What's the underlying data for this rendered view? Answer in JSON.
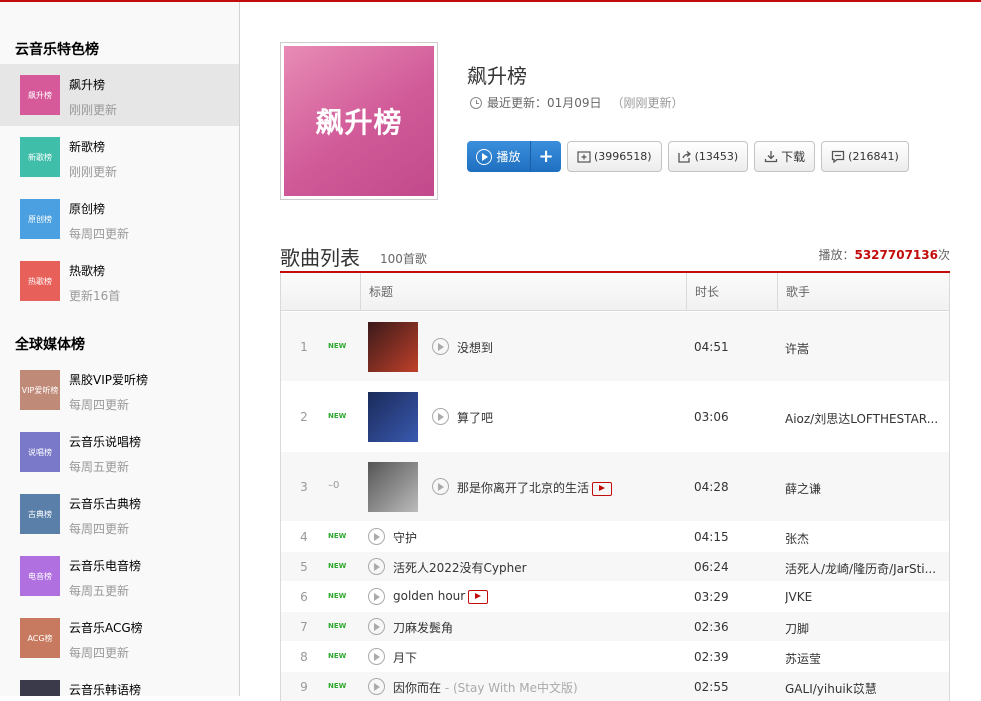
{
  "sidebar": {
    "sections": [
      {
        "title": "云音乐特色榜",
        "items": [
          {
            "name": "飙升榜",
            "update": "刚刚更新",
            "thumb_text": "飙升榜",
            "color": "#d65a9a",
            "active": true
          },
          {
            "name": "新歌榜",
            "update": "刚刚更新",
            "thumb_text": "新歌榜",
            "color": "#3fbfaa"
          },
          {
            "name": "原创榜",
            "update": "每周四更新",
            "thumb_text": "原创榜",
            "color": "#4aa0e0"
          },
          {
            "name": "热歌榜",
            "update": "更新16首",
            "thumb_text": "热歌榜",
            "color": "#e8605a"
          }
        ]
      },
      {
        "title": "全球媒体榜",
        "items": [
          {
            "name": "黑胶VIP爱听榜",
            "update": "每周四更新",
            "thumb_text": "VIP爱听榜",
            "color": "#c08a78"
          },
          {
            "name": "云音乐说唱榜",
            "update": "每周五更新",
            "thumb_text": "说唱榜",
            "color": "#7a78c8"
          },
          {
            "name": "云音乐古典榜",
            "update": "每周四更新",
            "thumb_text": "古典榜",
            "color": "#5a7fa8"
          },
          {
            "name": "云音乐电音榜",
            "update": "每周五更新",
            "thumb_text": "电音榜",
            "color": "#b070e0"
          },
          {
            "name": "云音乐ACG榜",
            "update": "每周四更新",
            "thumb_text": "ACG榜",
            "color": "#c87a60"
          },
          {
            "name": "云音乐韩语榜",
            "update": "",
            "thumb_text": "",
            "color": "#3a3a4a"
          }
        ]
      }
    ]
  },
  "header": {
    "cover_text": "飙升榜",
    "title": "飙升榜",
    "update_label": "最近更新：01月09日",
    "update_note": "（刚刚更新）",
    "play_label": "播放",
    "plus_label": "+",
    "collect_label": "(3996518)",
    "share_label": "(13453)",
    "download_label": "下载",
    "comment_label": "(216841)"
  },
  "songs": {
    "title": "歌曲列表",
    "count": "100首歌",
    "play_prefix": "播放：",
    "play_count": "5327707136",
    "play_suffix": "次",
    "columns": [
      "标题",
      "时长",
      "歌手"
    ],
    "rows": [
      {
        "rank": "1",
        "trend": "NEW",
        "title": "没想到",
        "alt": "",
        "mv": false,
        "duration": "04:51",
        "artist": "许嵩",
        "cover": true,
        "cover_colors": [
          "#3a1a1a",
          "#c0402a"
        ]
      },
      {
        "rank": "2",
        "trend": "NEW",
        "title": "算了吧",
        "alt": "",
        "mv": false,
        "duration": "03:06",
        "artist": "Aioz/刘思达LOFTHESTAR...",
        "cover": true,
        "cover_colors": [
          "#1a2a5a",
          "#3a5ab0"
        ]
      },
      {
        "rank": "3",
        "trend": "–0",
        "title": "那是你离开了北京的生活",
        "alt": "",
        "mv": true,
        "duration": "04:28",
        "artist": "薛之谦",
        "cover": true,
        "cover_colors": [
          "#555555",
          "#bbbbbb"
        ]
      },
      {
        "rank": "4",
        "trend": "NEW",
        "title": "守护",
        "alt": "",
        "mv": false,
        "duration": "04:15",
        "artist": "张杰",
        "cover": false
      },
      {
        "rank": "5",
        "trend": "NEW",
        "title": "活死人2022没有Cypher",
        "alt": "",
        "mv": false,
        "duration": "06:24",
        "artist": "活死人/龙崎/隆历奇/JarSti...",
        "cover": false
      },
      {
        "rank": "6",
        "trend": "NEW",
        "title": "golden hour",
        "alt": "",
        "mv": true,
        "duration": "03:29",
        "artist": "JVKE",
        "cover": false
      },
      {
        "rank": "7",
        "trend": "NEW",
        "title": "刀麻发鬓角",
        "alt": "",
        "mv": false,
        "duration": "02:36",
        "artist": "刀脚",
        "cover": false
      },
      {
        "rank": "8",
        "trend": "NEW",
        "title": "月下",
        "alt": "",
        "mv": false,
        "duration": "02:39",
        "artist": "苏运莹",
        "cover": false
      },
      {
        "rank": "9",
        "trend": "NEW",
        "title": "因你而在",
        "alt": " - (Stay With Me中文版)",
        "mv": false,
        "duration": "02:55",
        "artist": "GALI/yihuik苡慧",
        "cover": false
      }
    ]
  }
}
